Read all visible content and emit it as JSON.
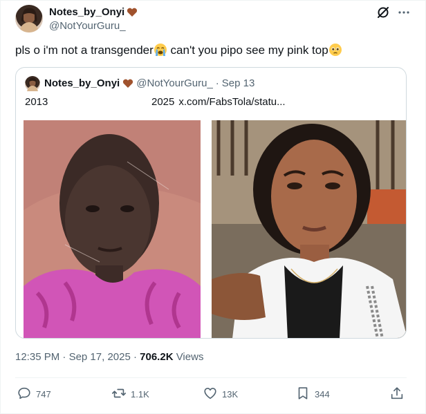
{
  "author": {
    "display_name": "Notes_by_Onyi",
    "handle": "@NotYourGuru_",
    "name_emoji": "brown-heart-icon"
  },
  "tweet": {
    "text_part1": "pls o i'm not a transgender",
    "emoji1": "crying-face-icon",
    "text_part2": " can't you pipo see my pink top",
    "emoji2": "pleading-face-icon"
  },
  "quote": {
    "display_name": "Notes_by_Onyi",
    "handle": "@NotYourGuru_",
    "separator": "·",
    "date": "Sep 13",
    "text_left": "2013",
    "text_right": "2025",
    "link": "x.com/FabsTola/statu...",
    "images": [
      {
        "icon": "photo-2013"
      },
      {
        "icon": "photo-2025"
      }
    ]
  },
  "meta": {
    "time": "12:35 PM",
    "separator1": "·",
    "date": "Sep 17, 2025",
    "separator2": "·",
    "views_count": "706.2K",
    "views_label": "Views"
  },
  "actions": {
    "replies": "747",
    "reposts": "1.1K",
    "likes": "13K",
    "bookmarks": "344"
  },
  "colors": {
    "text": "#0f1419",
    "secondary": "#536471",
    "border": "#cfd9de",
    "heart": "#a0522d"
  }
}
